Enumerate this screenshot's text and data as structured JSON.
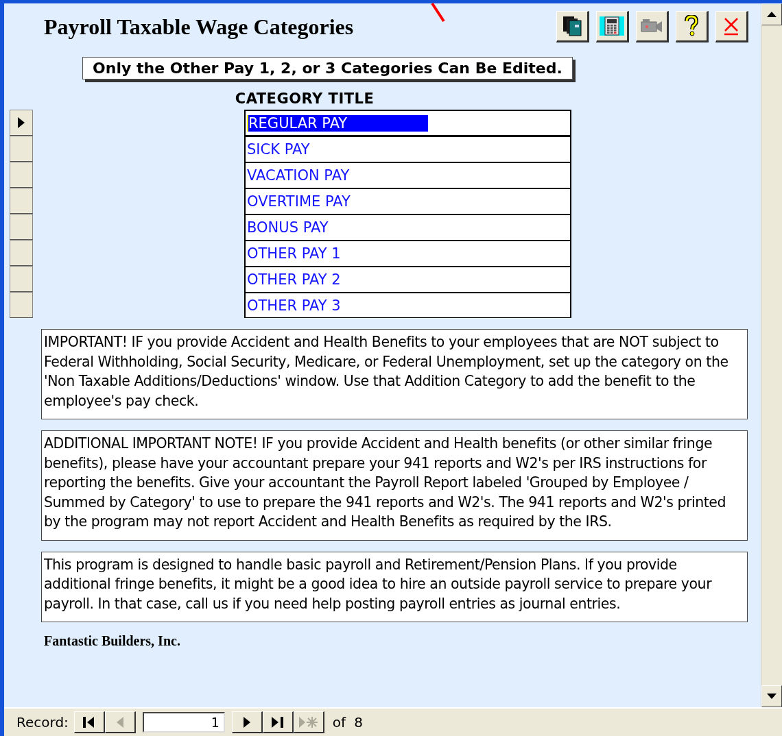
{
  "title": "Payroll Taxable Wage Categories",
  "notice": "Only the Other Pay 1, 2, or 3 Categories Can Be Edited.",
  "column_header": "CATEGORY TITLE",
  "rows": [
    {
      "text": "REGULAR PAY",
      "selected": true
    },
    {
      "text": "SICK PAY",
      "selected": false
    },
    {
      "text": "VACATION PAY",
      "selected": false
    },
    {
      "text": "OVERTIME PAY",
      "selected": false
    },
    {
      "text": "BONUS PAY",
      "selected": false
    },
    {
      "text": "OTHER PAY 1",
      "selected": false
    },
    {
      "text": "OTHER PAY 2",
      "selected": false
    },
    {
      "text": "OTHER PAY 3",
      "selected": false
    }
  ],
  "notes": [
    "IMPORTANT!  IF you provide Accident and Health Benefits to your employees that are NOT subject to Federal Withholding, Social Security, Medicare, or Federal Unemployment, set up the category on the 'Non Taxable Additions/Deductions' window.   Use that Addition Category to add the benefit to the employee's pay check.",
    "ADDITIONAL IMPORTANT NOTE!  IF you provide Accident and Health benefits (or other similar fringe benefits), please have your accountant prepare your 941 reports and W2's per IRS instructions for reporting the benefits.  Give your accountant the Payroll Report labeled 'Grouped by Employee / Summed by Category' to use to prepare the 941 reports and W2's.  The 941 reports and W2's printed by the program may not report Accident and Health Benefits as required by the IRS.",
    "This program is designed to handle basic payroll and Retirement/Pension Plans.  If you provide additional fringe benefits, it might be a good idea to hire an outside payroll service to prepare your payroll.   In that case, call us if you need help posting payroll entries as journal entries."
  ],
  "company": "Fantastic Builders, Inc.",
  "navigation": {
    "label": "Record:",
    "current": "1",
    "of": "of",
    "total": "8",
    "buttons": [
      {
        "kind": "first",
        "disabled": false
      },
      {
        "kind": "prev",
        "disabled": true
      },
      {
        "kind": "next",
        "disabled": false
      },
      {
        "kind": "last",
        "disabled": false
      },
      {
        "kind": "new",
        "disabled": true
      }
    ]
  }
}
